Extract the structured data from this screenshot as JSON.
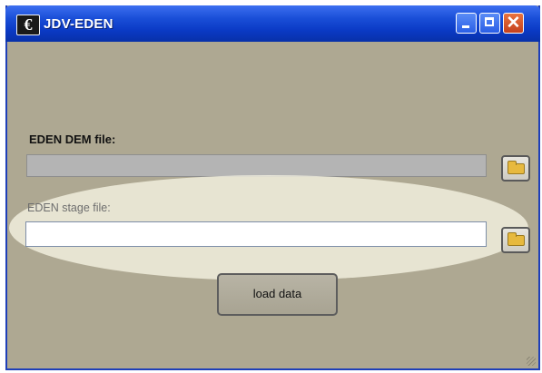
{
  "window": {
    "title": "JDV-EDEN",
    "app_icon_glyph": "€",
    "icons": [
      "app-icon",
      "minimize-icon",
      "maximize-icon",
      "close-icon",
      "folder-icon",
      "resize-grip-icon"
    ],
    "close_glyph": "✕"
  },
  "form": {
    "dem_label": "EDEN DEM file:",
    "dem_value": "",
    "stage_label": "EDEN stage file:",
    "stage_value": ""
  },
  "buttons": {
    "load_label": "load data"
  },
  "colors": {
    "titlebar": "#0a39c4",
    "window_bg": "#aea892",
    "highlight": "#f5f2e2",
    "close": "#c5401d"
  }
}
